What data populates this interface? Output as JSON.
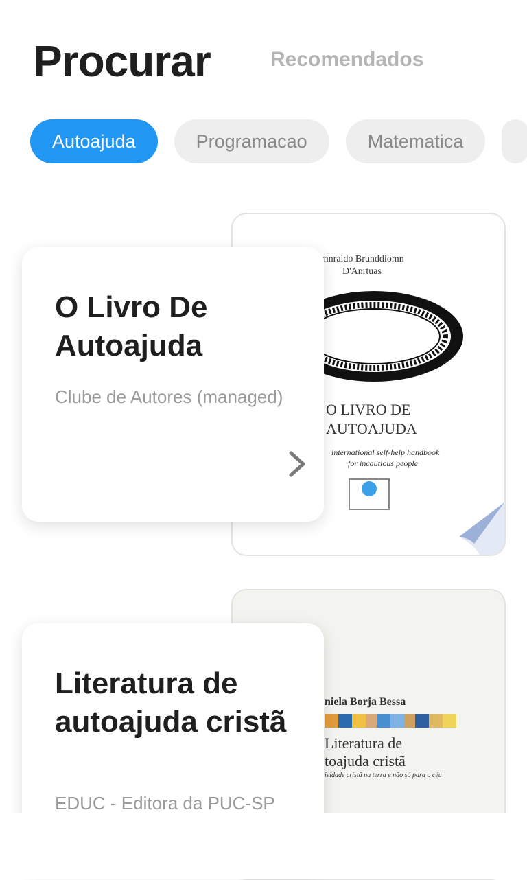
{
  "header": {
    "title": "Procurar",
    "recommended_tab": "Recomendados"
  },
  "categories": [
    "Autoajuda",
    "Programacao",
    "Matematica"
  ],
  "selected_category": "Autoajuda",
  "books": [
    {
      "title": "O Livro De Autoajuda",
      "author": "Clube de Autores (managed)",
      "cover": {
        "author_line1": "rnnraldo Brunddiomn",
        "author_line2": "D'Anrtuas",
        "title_line1": "O LIVRO DE",
        "title_line2": "AUTOAJUDA",
        "subtitle1": "international self-help handbook",
        "subtitle2": "for incautious people"
      }
    },
    {
      "title": "Literatura de autoajuda cristã",
      "author": "EDUC - Editora da PUC-SP",
      "cover": {
        "author_line": "niela Borja Bessa",
        "title_line1": "Literatura de",
        "title_line2": "toajuda cristã",
        "subtitle": "ividade cristã na terra e não só para o céu"
      }
    }
  ],
  "colors": {
    "accent": "#2196f3",
    "chip_bg": "#eeeeee",
    "text_dark": "#1f1f1f",
    "text_muted": "#9a9a9a"
  }
}
